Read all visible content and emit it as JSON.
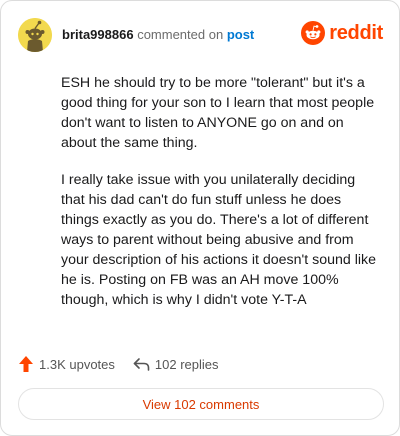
{
  "header": {
    "username": "brita998866",
    "action": "commented on",
    "post_link": "post",
    "logo_text": "reddit"
  },
  "comment": {
    "paragraphs": [
      "ESH he should try to be more \"tolerant\" but it's a good thing for your son to I learn that most people don't want to listen to ANYONE go on and on about the same thing.",
      "I really take issue with you unilaterally deciding that his dad can't do fun stuff unless he does things exactly as you do. There's a lot of different ways to parent without being abusive and from your description of his actions it doesn't sound like he is. Posting on FB was an AH move 100% though, which is why I didn't vote Y-T-A"
    ]
  },
  "footer": {
    "upvotes": "1.3K upvotes",
    "replies": "102 replies",
    "view_comments": "View 102 comments"
  },
  "icons": {
    "avatar": "snoo-avatar-icon",
    "logo": "reddit-logo-icon",
    "upvote": "upvote-arrow-icon",
    "reply": "reply-arrow-icon"
  },
  "colors": {
    "brand": "#ff4500",
    "link": "#0079d3",
    "avatar_bg": "#f2d94e",
    "button_text": "#d93a00"
  }
}
